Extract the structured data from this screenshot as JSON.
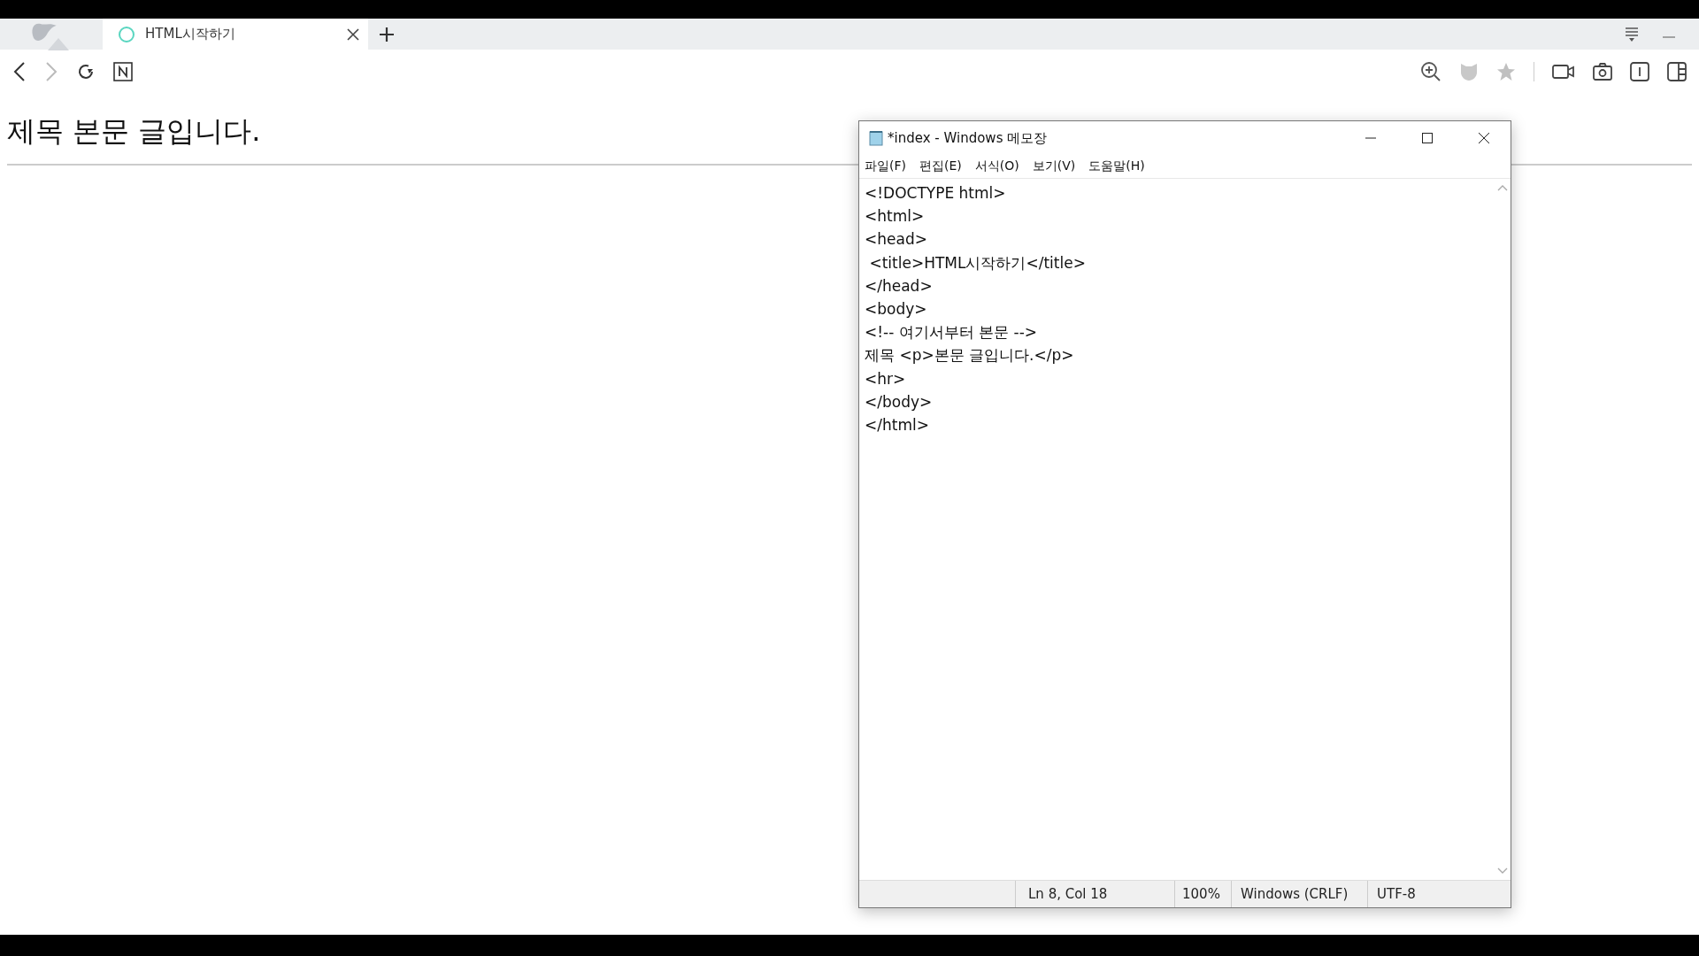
{
  "browser": {
    "tabs": [
      {
        "title": "HTML시작하기",
        "selected": true
      }
    ]
  },
  "page": {
    "text": "제목 본문 글입니다."
  },
  "notepad": {
    "title": "*index - Windows 메모장",
    "menu": [
      "파일(F)",
      "편집(E)",
      "서식(O)",
      "보기(V)",
      "도움말(H)"
    ],
    "lines": [
      "<!DOCTYPE html>",
      "<html>",
      "<head>",
      " <title>HTML시작하기</title>",
      "</head>",
      "<body>",
      "<!-- 여기서부터 본문 -->",
      "제목 <p>본문 글입니다.</p>",
      "<hr>",
      "</body>",
      "</html>"
    ],
    "status_bar": [
      "Ln 8, Col 18",
      "100%",
      "Windows (CRLF)",
      "UTF-8"
    ]
  }
}
